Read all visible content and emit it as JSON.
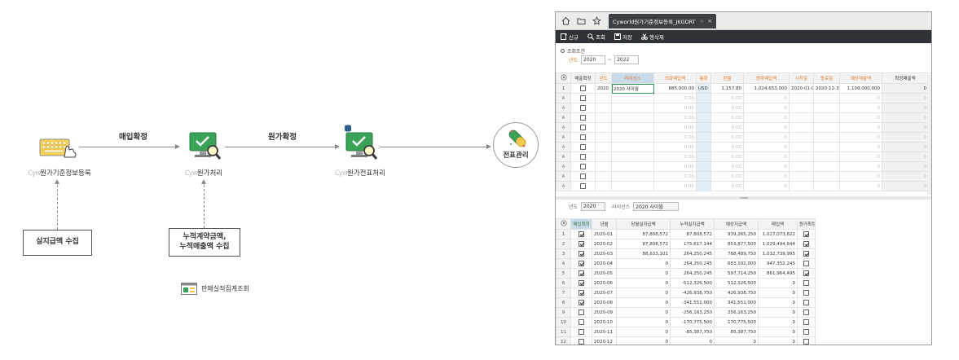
{
  "flow": {
    "node1": {
      "label_blur": "Cyw",
      "label": "원가기준정보등록"
    },
    "node2": {
      "label_blur": "Cyw",
      "label": "원가처리"
    },
    "node3": {
      "label_blur": "Cyw",
      "label": "원가전표처리"
    },
    "node4": {
      "label": "전표관리"
    },
    "arrow1": "매입확정",
    "arrow2": "원가확정",
    "box1": "실지급액 수집",
    "box2_line1": "누적계약금액,",
    "box2_line2": "누적매출액 수집",
    "report": "판매실적집계조회"
  },
  "window": {
    "tab_title": "Cyworld원가기준정보등록_JKGDRT",
    "tab_star": "☆",
    "tab_close": "✕",
    "toolbar": {
      "new": "신규",
      "search": "조회",
      "save": "저장",
      "delete_row": "행삭제"
    },
    "cond": {
      "title": "조회조건",
      "year_label": "년도",
      "year_from": "2020",
      "tilde": "~",
      "year_to": "2022"
    },
    "grid1": {
      "headers": [
        "매출확정",
        "년도",
        "라이선스",
        "외화매입액",
        "통화",
        "환율",
        "원화매입액",
        "시작일",
        "종료일",
        "예상매출액",
        "확정매출액"
      ],
      "row1": {
        "num": "1",
        "year": "2020",
        "license": "2020 사이월",
        "foreign": "885,000.00",
        "currency": "USD",
        "rate": "1,157.80",
        "krw": "1,024,653,000",
        "start": "2020-01-01",
        "end": "2020-12-31",
        "expected": "1,109,000,000",
        "confirmed": "0"
      },
      "empty_marker": "A",
      "zero_foreign": "0.00",
      "zero_rate": "0.00",
      "zero": "0"
    },
    "mid": {
      "year_label": "년도",
      "year": "2020",
      "license_label": "라이선스",
      "license": "2020 사이월"
    },
    "grid2": {
      "headers": [
        "매입확정",
        "년월",
        "당월실지급액",
        "누적실지급액",
        "예상지급액",
        "매입액",
        "원가확정"
      ],
      "rows": [
        {
          "n": "1",
          "ym": "2020-01",
          "cur": "87,808,572",
          "acc": "87,808,572",
          "exp": "939,265,250",
          "buy": "1,027,073,822",
          "c1": true,
          "c2": true
        },
        {
          "n": "2",
          "ym": "2020-02",
          "cur": "87,808,572",
          "acc": "175,617,144",
          "exp": "853,877,500",
          "buy": "1,029,494,644",
          "c1": true,
          "c2": true
        },
        {
          "n": "3",
          "ym": "2020-03",
          "cur": "88,633,101",
          "acc": "264,250,245",
          "exp": "768,489,750",
          "buy": "1,032,739,995",
          "c1": true,
          "c2": true
        },
        {
          "n": "4",
          "ym": "2020-04",
          "cur": "0",
          "acc": "264,250,245",
          "exp": "683,102,000",
          "buy": "947,352,245",
          "c1": true,
          "c2": false
        },
        {
          "n": "5",
          "ym": "2020-05",
          "cur": "0",
          "acc": "264,250,245",
          "exp": "597,714,250",
          "buy": "861,964,495",
          "c1": true,
          "c2": true
        },
        {
          "n": "6",
          "ym": "2020-06",
          "cur": "0",
          "acc": "-512,326,500",
          "exp": "512,326,500",
          "buy": "0",
          "c1": true,
          "c2": false
        },
        {
          "n": "7",
          "ym": "2020-07",
          "cur": "0",
          "acc": "-426,938,750",
          "exp": "426,938,750",
          "buy": "0",
          "c1": true,
          "c2": false
        },
        {
          "n": "8",
          "ym": "2020-08",
          "cur": "0",
          "acc": "-341,551,000",
          "exp": "341,551,000",
          "buy": "0",
          "c1": true,
          "c2": false
        },
        {
          "n": "9",
          "ym": "2020-09",
          "cur": "0",
          "acc": "-256,163,250",
          "exp": "256,163,250",
          "buy": "0",
          "c1": false,
          "c2": false
        },
        {
          "n": "10",
          "ym": "2020-10",
          "cur": "0",
          "acc": "-170,775,500",
          "exp": "170,775,500",
          "buy": "0",
          "c1": false,
          "c2": false
        },
        {
          "n": "11",
          "ym": "2020-11",
          "cur": "0",
          "acc": "-85,387,750",
          "exp": "85,387,750",
          "buy": "0",
          "c1": false,
          "c2": false
        },
        {
          "n": "12",
          "ym": "2020-12",
          "cur": "0",
          "acc": "0",
          "exp": "0",
          "buy": "0",
          "c1": false,
          "c2": false
        }
      ]
    }
  },
  "colors": {
    "accent_orange": "#e07b2c",
    "toolbar_bg": "#2f3236",
    "icon_green": "#3aa357",
    "icon_yellow": "#f2c94c"
  }
}
